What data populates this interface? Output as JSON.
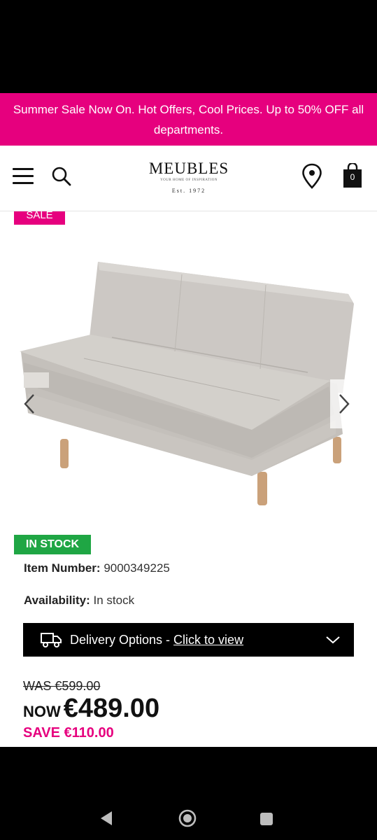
{
  "promo_banner": {
    "text": "Summer Sale Now On. Hot Offers, Cool Prices. Up to 50% OFF all departments."
  },
  "header": {
    "logo": {
      "name": "MEUBLES",
      "tagline": "YOUR HOME OF INSPIRATION",
      "established": "Est. 1972"
    },
    "icons": [
      "menu-icon",
      "search-icon",
      "location-pin-icon",
      "shopping-bag-icon"
    ],
    "cart_count": "0"
  },
  "product": {
    "sale_badge": "SALE",
    "image": "grey fabric sofa bed with wooden legs",
    "stock_badge": "IN STOCK",
    "item_number_label": "Item Number:",
    "item_number": "9000349225",
    "availability_label": "Availability:",
    "availability": "In stock",
    "delivery": {
      "label": "Delivery Options - ",
      "link": "Click to view"
    },
    "was_price": "WAS €599.00",
    "now_label": "NOW",
    "now_price": "€489.00",
    "save_text": "SAVE €110.00"
  },
  "colors": {
    "accent": "#e6007e",
    "stock_green": "#1fa644",
    "dark": "#000000"
  },
  "system_nav": {
    "icons": [
      "back-icon",
      "home-icon",
      "recents-icon"
    ]
  }
}
